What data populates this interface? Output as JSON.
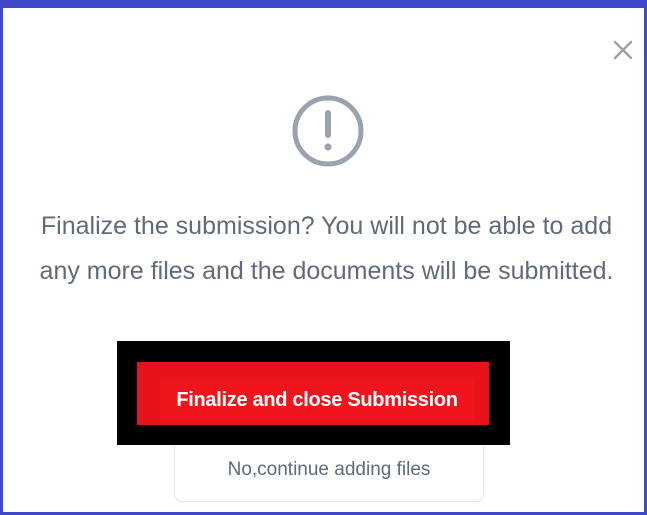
{
  "dialog": {
    "message": "Finalize the submission? You will not be able to add any more files and the documents will be submitted.",
    "icon": "exclamation-circle-icon",
    "close_icon": "close-icon",
    "finalize_label": "Finalize and close Submission",
    "continue_label": "No,continue adding files"
  },
  "colors": {
    "frame_border": "#4049c9",
    "primary_button": "#f0141c",
    "icon_gray": "#9aa2ad",
    "text_gray": "#5f6b7a"
  }
}
